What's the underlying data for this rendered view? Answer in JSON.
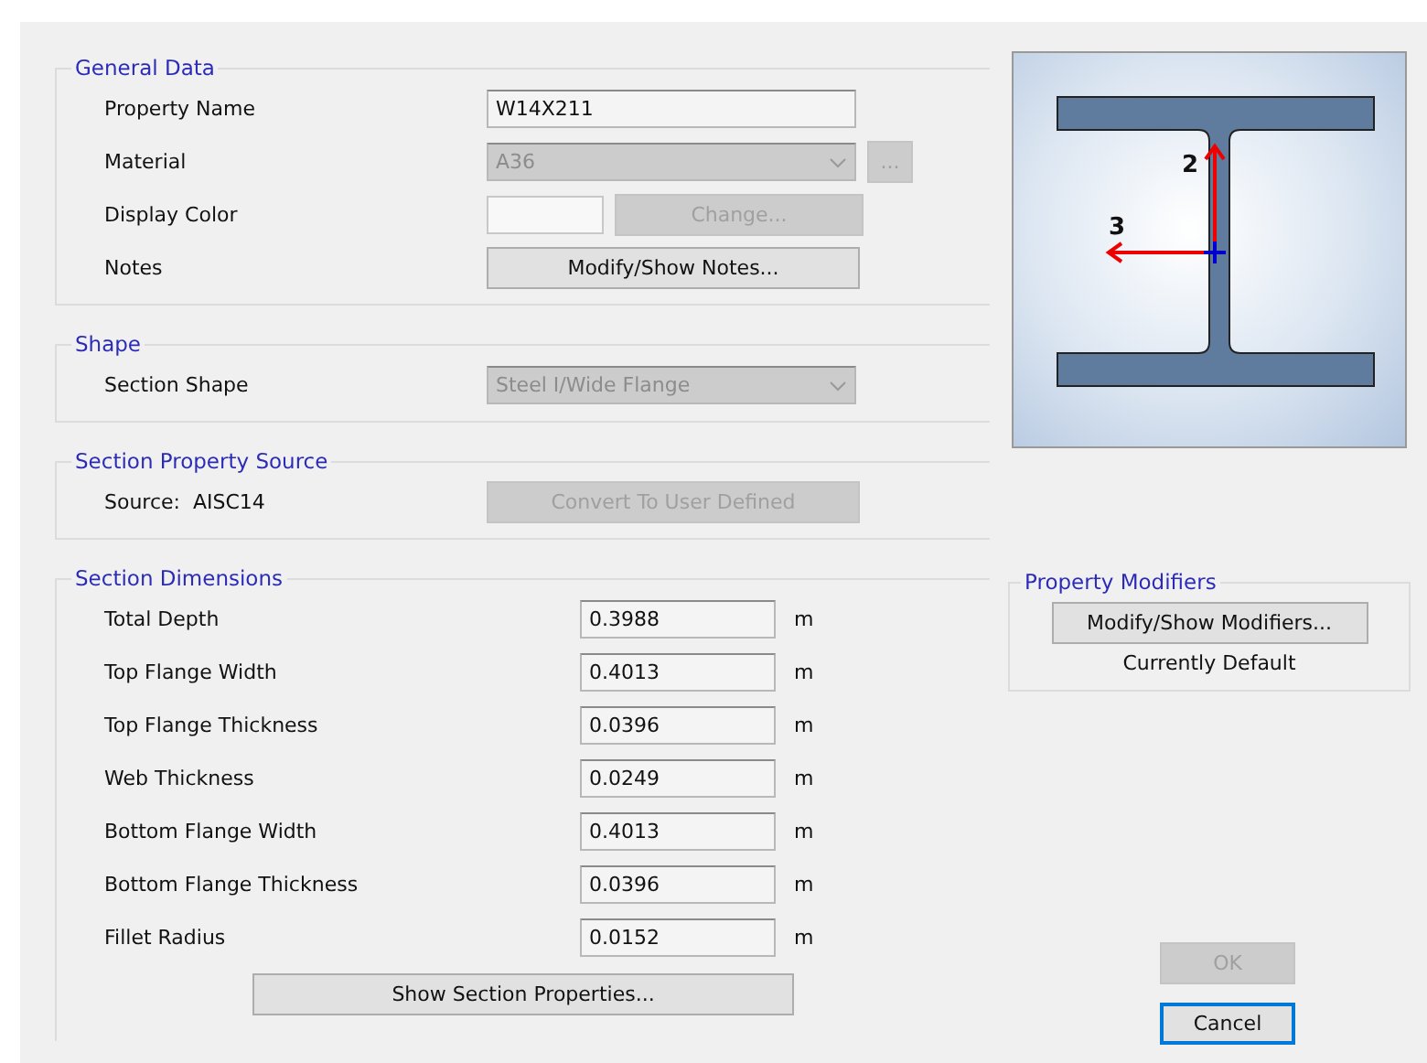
{
  "general_data": {
    "title": "General Data",
    "property_name": {
      "label": "Property Name",
      "value": "W14X211"
    },
    "material": {
      "label": "Material",
      "value": "A36",
      "disabled": true,
      "browse_button": {
        "label": "...",
        "disabled": true
      }
    },
    "display_color": {
      "label": "Display Color",
      "color": "#f8f8f8",
      "button": {
        "label": "Change...",
        "disabled": true
      }
    },
    "notes": {
      "label": "Notes",
      "button": {
        "label": "Modify/Show Notes...",
        "disabled": false
      }
    }
  },
  "shape": {
    "title": "Shape",
    "label": "Section Shape",
    "value": "Steel I/Wide Flange",
    "disabled": true
  },
  "source": {
    "title": "Section Property Source",
    "label": "Source:  AISC14",
    "button": {
      "label": "Convert To User Defined",
      "disabled": true
    }
  },
  "dimensions": {
    "title": "Section Dimensions",
    "rows": [
      {
        "label": "Total Depth",
        "value": "0.3988",
        "unit": "m"
      },
      {
        "label": "Top Flange Width",
        "value": "0.4013",
        "unit": "m"
      },
      {
        "label": "Top Flange Thickness",
        "value": "0.0396",
        "unit": "m"
      },
      {
        "label": "Web Thickness",
        "value": "0.0249",
        "unit": "m"
      },
      {
        "label": "Bottom Flange Width",
        "value": "0.4013",
        "unit": "m"
      },
      {
        "label": "Bottom Flange Thickness",
        "value": "0.0396",
        "unit": "m"
      },
      {
        "label": "Fillet Radius",
        "value": "0.0152",
        "unit": "m"
      }
    ],
    "button": {
      "label": "Show Section Properties...",
      "disabled": false
    }
  },
  "preview": {
    "axis_2": "2",
    "axis_3": "3"
  },
  "modifiers": {
    "title": "Property Modifiers",
    "button": {
      "label": "Modify/Show Modifiers...",
      "disabled": false
    },
    "status": "Currently Default"
  },
  "buttons": [
    {
      "label": "OK",
      "disabled": true,
      "focused": false
    },
    {
      "label": "Cancel",
      "disabled": false,
      "focused": true
    }
  ]
}
